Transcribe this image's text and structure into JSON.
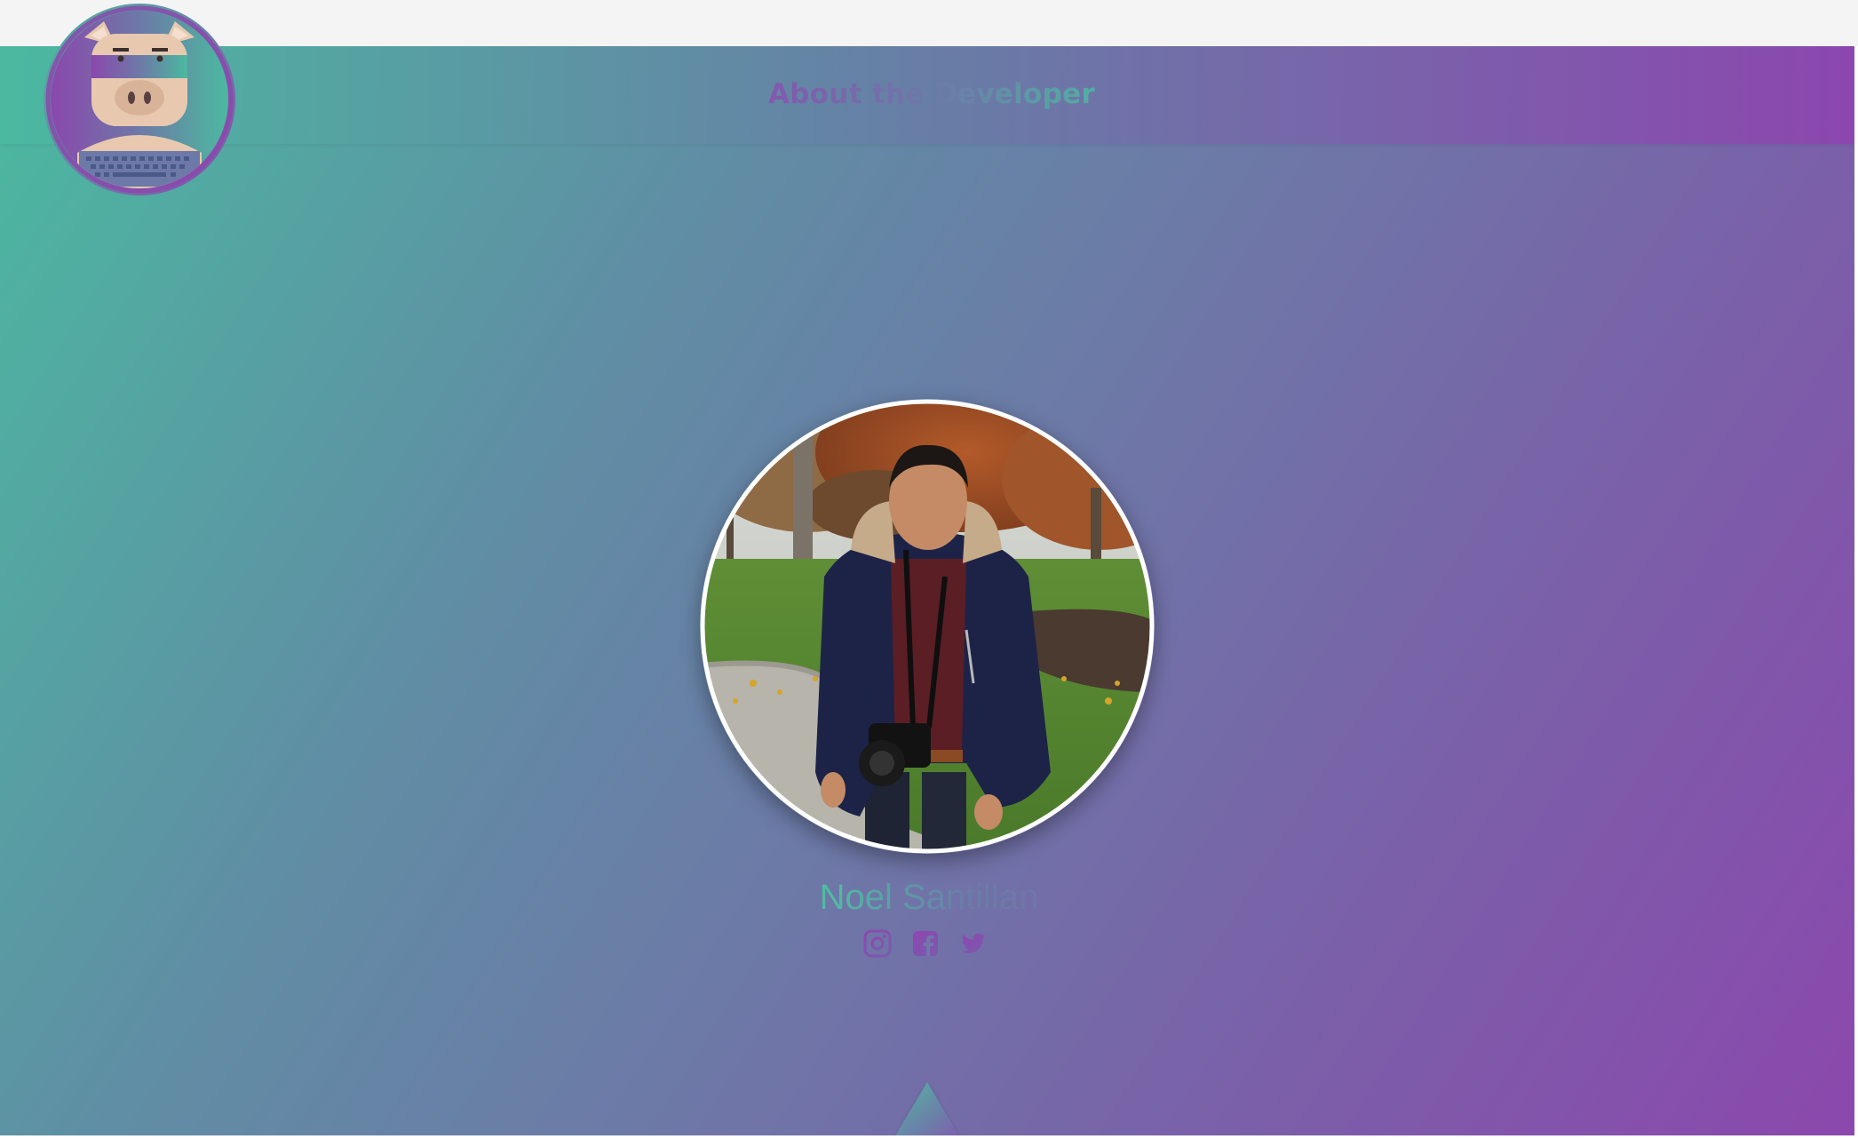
{
  "header": {
    "title": "About the Developer"
  },
  "logo": {
    "icon": "pig-mascot-icon"
  },
  "profile": {
    "photo_icon": "developer-photo",
    "name": "Noel Santillan"
  },
  "socials": [
    {
      "icon": "instagram-icon"
    },
    {
      "icon": "facebook-icon"
    },
    {
      "icon": "twitter-icon"
    }
  ],
  "scroll_top": {
    "icon": "triangle-up-icon"
  },
  "colors": {
    "teal": "#4bb9a0",
    "purple": "#8b48ad",
    "slate": "#6d79a7"
  }
}
